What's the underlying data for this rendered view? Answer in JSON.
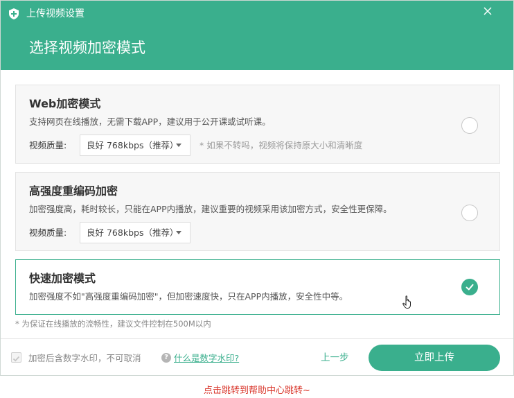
{
  "window": {
    "title": "上传视频设置",
    "heading": "选择视频加密模式"
  },
  "modes": [
    {
      "title": "Web加密模式",
      "desc": "支持网页在线播放，无需下载APP，建议用于公开课或试听课。",
      "quality_label": "视频质量:",
      "quality_value": "良好 768kbps（推荐）",
      "quality_note": "* 如果不转吗，视频将保持原大小和清晰度",
      "selected": false
    },
    {
      "title": "高强度重编码加密",
      "desc": "加密强度高，耗时较长，只能在APP内播放，建议重要的视频采用该加密方式，安全性更保障。",
      "quality_label": "视频质量:",
      "quality_value": "良好 768kbps（推荐）",
      "selected": false
    },
    {
      "title": "快速加密模式",
      "desc": "加密强度不如\"高强度重编码加密\"，但加密速度快，只在APP内播放，安全性中等。",
      "selected": true
    }
  ],
  "size_note": "* 为保证在线播放的流畅性，建议文件控制在500M以内",
  "footer": {
    "watermark_label": "加密后含数字水印，不可取消",
    "watermark_checked": true,
    "watermark_link": "什么是数字水印?",
    "prev_label": "上一步",
    "upload_label": "立即上传"
  },
  "help_jump": "点击跳转到帮助中心跳转~",
  "colors": {
    "accent": "#3aaf8d",
    "link_red": "#d9362b"
  },
  "icons": {
    "title_icon": "shield-plus-icon",
    "close": "close-icon",
    "selected": "checkmark-icon",
    "dropdown": "triangle-down-icon",
    "help": "question-circle-icon",
    "pointer": "hand-cursor-icon"
  }
}
